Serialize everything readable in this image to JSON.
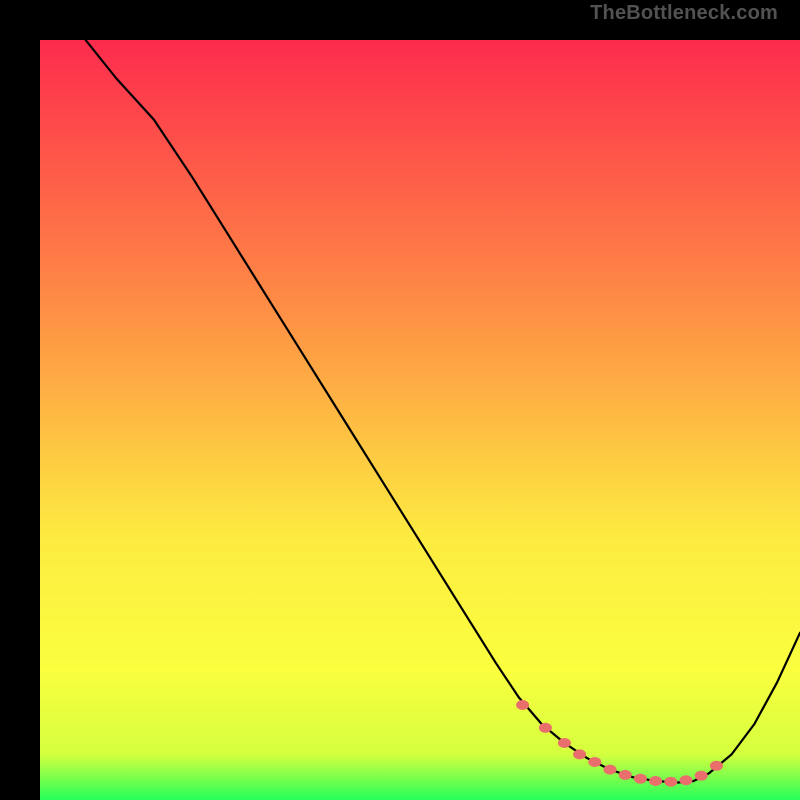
{
  "watermark": "TheBottleneck.com",
  "colors": {
    "black": "#000000",
    "marker": "#ea6e6b",
    "gradient_top": "#fd2b4d",
    "gradient_mid1": "#fe8d45",
    "gradient_mid2": "#fdea41",
    "gradient_mid3": "#faff3e",
    "gradient_mid4": "#d4ff3e",
    "gradient_bottom": "#25ff59"
  },
  "chart_data": {
    "type": "line",
    "title": "",
    "xlabel": "",
    "ylabel": "",
    "xlim": [
      0,
      100
    ],
    "ylim": [
      0,
      100
    ],
    "series": [
      {
        "name": "curve",
        "x": [
          6,
          10,
          15,
          20,
          25,
          30,
          35,
          40,
          45,
          50,
          55,
          60,
          63,
          66,
          69,
          72,
          75,
          78,
          81,
          84,
          86,
          88,
          91,
          94,
          97,
          100
        ],
        "y": [
          100,
          95,
          89.5,
          82,
          74,
          66,
          58,
          50,
          42,
          34,
          26,
          18,
          13.5,
          10,
          7.5,
          5.5,
          4,
          3,
          2.5,
          2.3,
          2.5,
          3.5,
          6,
          10,
          15.5,
          22
        ]
      }
    ],
    "markers": {
      "name": "dotted-valley",
      "x": [
        63.5,
        66.5,
        69,
        71,
        73,
        75,
        77,
        79,
        81,
        83,
        85,
        87,
        89
      ],
      "y": [
        12.5,
        9.5,
        7.5,
        6,
        5,
        4,
        3.3,
        2.8,
        2.5,
        2.4,
        2.6,
        3.2,
        4.5
      ]
    }
  }
}
